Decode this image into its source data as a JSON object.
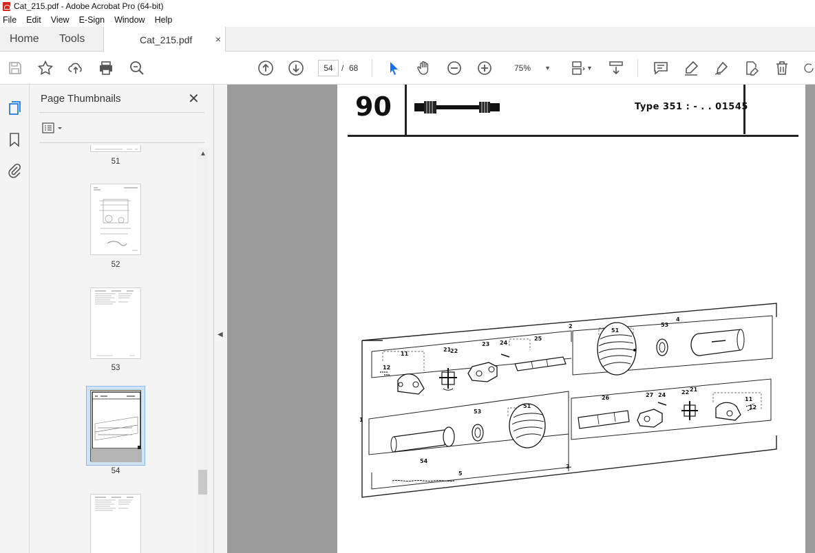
{
  "window": {
    "title": "Cat_215.pdf - Adobe Acrobat Pro (64-bit)"
  },
  "menu": {
    "items": [
      "File",
      "Edit",
      "View",
      "E-Sign",
      "Window",
      "Help"
    ]
  },
  "tabs": {
    "home": "Home",
    "tools": "Tools",
    "document": "Cat_215.pdf",
    "close": "×"
  },
  "toolbar": {
    "current_page": "54",
    "page_separator": "/",
    "total_pages": "68",
    "zoom": "75%",
    "icons": [
      "save-icon",
      "bookmark-star-icon",
      "upload-icon",
      "print-icon",
      "zoom-search-icon",
      "page-up-icon",
      "page-down-icon",
      "select-pointer-icon",
      "hand-icon",
      "zoom-out-icon",
      "zoom-in-icon",
      "fit-page-icon",
      "scroll-mode-icon",
      "comment-icon",
      "highlight-icon",
      "sign-icon",
      "edit-pdf-icon",
      "delete-icon",
      "rotate-icon"
    ]
  },
  "thumbnails_panel": {
    "title": "Page Thumbnails",
    "close": "✕",
    "pages": [
      {
        "label": "51"
      },
      {
        "label": "52"
      },
      {
        "label": "53"
      },
      {
        "label": "54",
        "selected": true
      },
      {
        "label": ""
      }
    ]
  },
  "document_page": {
    "number": "90",
    "type_text": "Type  351 : - . . 01545",
    "part_labels": [
      "1",
      "2",
      "3",
      "4",
      "5",
      "11",
      "12",
      "21",
      "22",
      "23",
      "24",
      "25",
      "26",
      "27",
      "51",
      "53",
      "54"
    ]
  },
  "colors": {
    "accent": "#1473e6",
    "selected_thumb_bg": "#cfe3f7",
    "doc_bg": "#9b9b9b"
  }
}
